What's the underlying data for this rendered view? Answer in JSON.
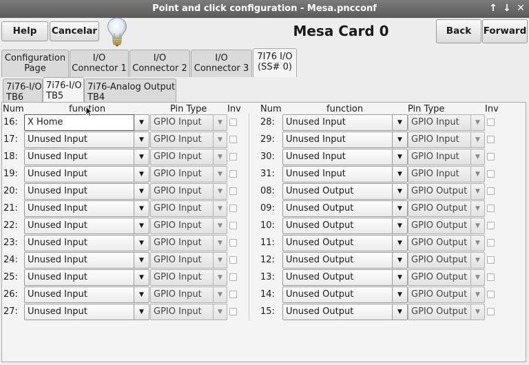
{
  "window": {
    "title": "Point and click configuration - Mesa.pncconf",
    "controls": [
      "↑",
      "↓",
      "✕"
    ]
  },
  "toolbar": {
    "help": "Help",
    "cancel": "Cancelar",
    "heading": "Mesa Card 0",
    "back": "Back",
    "forward": "Forward"
  },
  "tabs": [
    {
      "line1": "Configuration",
      "line2": "Page"
    },
    {
      "line1": "I/O",
      "line2": "Connector 1"
    },
    {
      "line1": "I/O",
      "line2": "Connector 2"
    },
    {
      "line1": "I/O",
      "line2": "Connector 3"
    },
    {
      "line1": "7I76 I/O",
      "line2": "(SS# 0)"
    }
  ],
  "subtabs": [
    {
      "line1": "7i76-I/O",
      "line2": "TB6"
    },
    {
      "line1": "7i76-I/O",
      "line2": "TB5"
    },
    {
      "line1": "7i76-Analog Output",
      "line2": "TB4"
    }
  ],
  "headers": {
    "num": "Num",
    "function": "function",
    "pin_type": "Pin Type",
    "inv": "Inv"
  },
  "left_rows": [
    {
      "num": "16:",
      "function": "X Home",
      "pin_type": "GPIO Input"
    },
    {
      "num": "17:",
      "function": "Unused Input",
      "pin_type": "GPIO Input"
    },
    {
      "num": "18:",
      "function": "Unused Input",
      "pin_type": "GPIO Input"
    },
    {
      "num": "19:",
      "function": "Unused Input",
      "pin_type": "GPIO Input"
    },
    {
      "num": "20:",
      "function": "Unused Input",
      "pin_type": "GPIO Input"
    },
    {
      "num": "21:",
      "function": "Unused Input",
      "pin_type": "GPIO Input"
    },
    {
      "num": "22:",
      "function": "Unused Input",
      "pin_type": "GPIO Input"
    },
    {
      "num": "23:",
      "function": "Unused Input",
      "pin_type": "GPIO Input"
    },
    {
      "num": "24:",
      "function": "Unused Input",
      "pin_type": "GPIO Input"
    },
    {
      "num": "25:",
      "function": "Unused Input",
      "pin_type": "GPIO Input"
    },
    {
      "num": "26:",
      "function": "Unused Input",
      "pin_type": "GPIO Input"
    },
    {
      "num": "27:",
      "function": "Unused Input",
      "pin_type": "GPIO Input"
    }
  ],
  "right_rows": [
    {
      "num": "28:",
      "function": "Unused Input",
      "pin_type": "GPIO Input"
    },
    {
      "num": "29:",
      "function": "Unused Input",
      "pin_type": "GPIO Input"
    },
    {
      "num": "30:",
      "function": "Unused Input",
      "pin_type": "GPIO Input"
    },
    {
      "num": "31:",
      "function": "Unused Input",
      "pin_type": "GPIO Input"
    },
    {
      "num": "08:",
      "function": "Unused Output",
      "pin_type": "GPIO Output"
    },
    {
      "num": "09:",
      "function": "Unused Output",
      "pin_type": "GPIO Output"
    },
    {
      "num": "10:",
      "function": "Unused Output",
      "pin_type": "GPIO Output"
    },
    {
      "num": "11:",
      "function": "Unused Output",
      "pin_type": "GPIO Output"
    },
    {
      "num": "12:",
      "function": "Unused Output",
      "pin_type": "GPIO Output"
    },
    {
      "num": "13:",
      "function": "Unused Output",
      "pin_type": "GPIO Output"
    },
    {
      "num": "14:",
      "function": "Unused Output",
      "pin_type": "GPIO Output"
    },
    {
      "num": "15:",
      "function": "Unused Output",
      "pin_type": "GPIO Output"
    }
  ],
  "icons": {
    "bulb": "lightbulb-icon",
    "dropdown": "dropdown-arrow-icon",
    "cursor": "mouse-pointer-icon"
  }
}
